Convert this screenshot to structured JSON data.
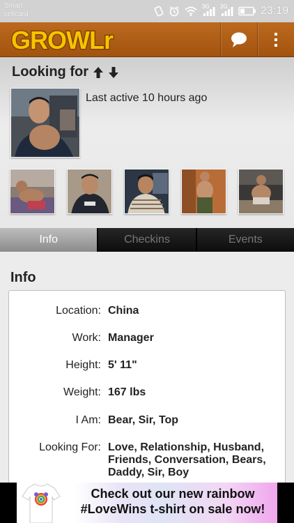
{
  "status_bar": {
    "carrier_line1": "Smart",
    "carrier_line2": "cellcard",
    "network1": "3G",
    "network2": "2G",
    "time": "23:19"
  },
  "app_bar": {
    "logo_text": "GROWLr",
    "brand_color": "#a95a14",
    "logo_color": "#f5c400"
  },
  "profile": {
    "looking_for_title": "Looking for",
    "last_active": "Last active 10 hours ago"
  },
  "tabs": [
    {
      "label": "Info",
      "active": true
    },
    {
      "label": "Checkins",
      "active": false
    },
    {
      "label": "Events",
      "active": false
    }
  ],
  "info": {
    "heading": "Info",
    "rows": [
      {
        "key": "Location:",
        "value": "China"
      },
      {
        "key": "Work:",
        "value": "Manager"
      },
      {
        "key": "Height:",
        "value": "5' 11\""
      },
      {
        "key": "Weight:",
        "value": "167 lbs"
      },
      {
        "key": "I Am:",
        "value": "Bear, Sir, Top"
      },
      {
        "key": "Looking For:",
        "value": "Love, Relationship, Husband, Friends, Conversation, Bears, Daddy, Sir, Boy"
      }
    ]
  },
  "ad": {
    "line1": "Check out our new rainbow",
    "line2": "#LoveWins t-shirt on sale now!"
  }
}
